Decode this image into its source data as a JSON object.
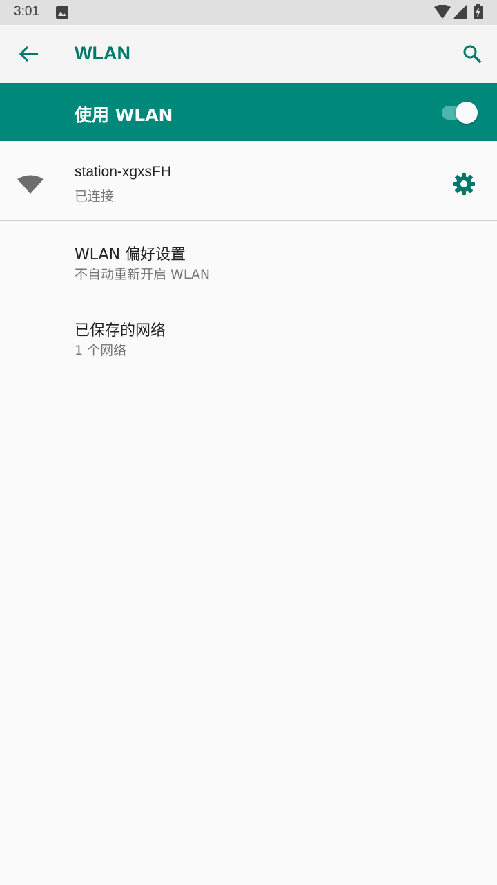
{
  "status_bar": {
    "time": "3:01",
    "icons": [
      "image-notification-icon",
      "wifi-signal-icon",
      "cell-signal-icon",
      "battery-charging-icon"
    ]
  },
  "app_bar": {
    "title": "WLAN",
    "back_icon": "arrow-back-icon",
    "search_icon": "search-icon"
  },
  "master_switch": {
    "label": "使用 WLAN",
    "enabled": true
  },
  "connected_network": {
    "name": "station-xgxsFH",
    "status": "已连接",
    "icon": "wifi-icon",
    "settings_icon": "gear-icon"
  },
  "preferences": [
    {
      "title": "WLAN 偏好设置",
      "summary": "不自动重新开启 WLAN"
    },
    {
      "title": "已保存的网络",
      "summary": "1 个网络"
    }
  ],
  "colors": {
    "accent": "#00796b",
    "switch_bar": "#00897b",
    "toggle_track": "#4db6ac",
    "background": "#fafafa",
    "status_bar": "#e0e0e0"
  }
}
